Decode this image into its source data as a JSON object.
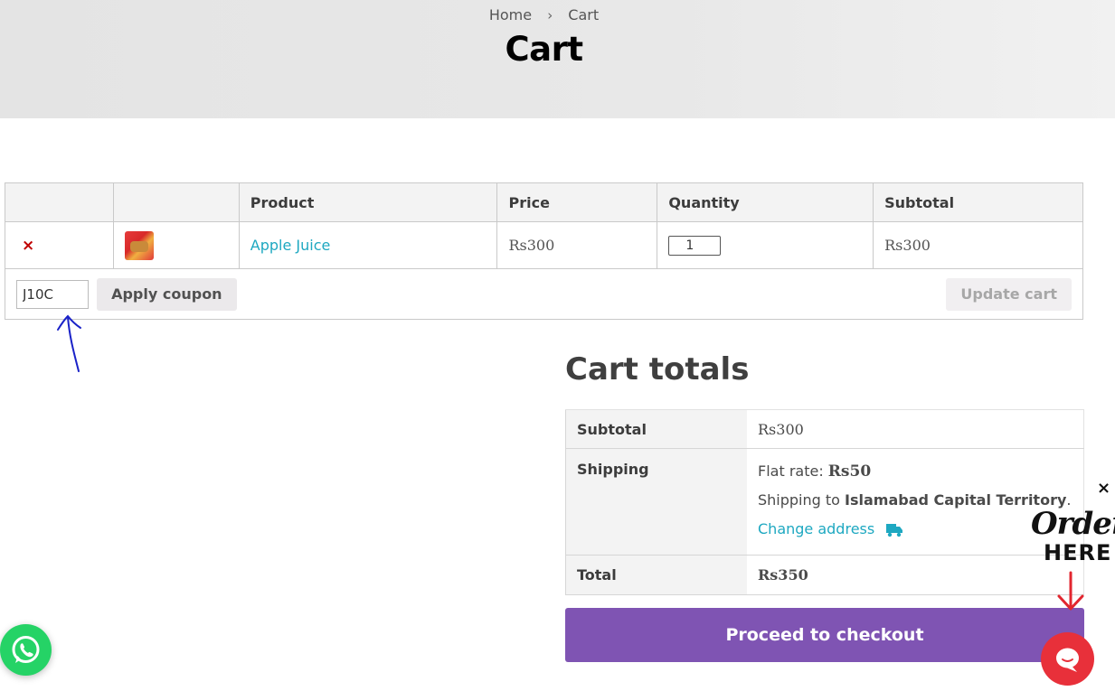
{
  "header": {
    "breadcrumb": [
      "Home",
      "Cart"
    ],
    "breadcrumb_separator": "›",
    "title": "Cart"
  },
  "cart": {
    "columns": [
      "",
      "",
      "Product",
      "Price",
      "Quantity",
      "Subtotal"
    ],
    "items": [
      {
        "remove": "×",
        "name": "Apple Juice",
        "price": "Rs300",
        "quantity": "1",
        "subtotal": "Rs300"
      }
    ],
    "coupon": {
      "value": "J10C",
      "apply_label": "Apply coupon"
    },
    "update_label": "Update cart"
  },
  "totals": {
    "title": "Cart totals",
    "subtotal_label": "Subtotal",
    "subtotal_value": "Rs300",
    "shipping_label": "Shipping",
    "flat_rate_label": "Flat rate:",
    "flat_rate_value": "Rs50",
    "shipping_to_text": "Shipping to",
    "shipping_region": "Islamabad Capital Territory",
    "shipping_period": ".",
    "change_address": "Change address",
    "total_label": "Total",
    "total_value": "Rs350",
    "checkout_label": "Proceed to checkout"
  },
  "widgets": {
    "close_label": "×",
    "order_word": "Order",
    "here_word": "HERE"
  },
  "colors": {
    "accent": "#7f54b3",
    "link": "#1ea8c1",
    "whatsapp": "#25d366",
    "chat": "#e8303a"
  }
}
